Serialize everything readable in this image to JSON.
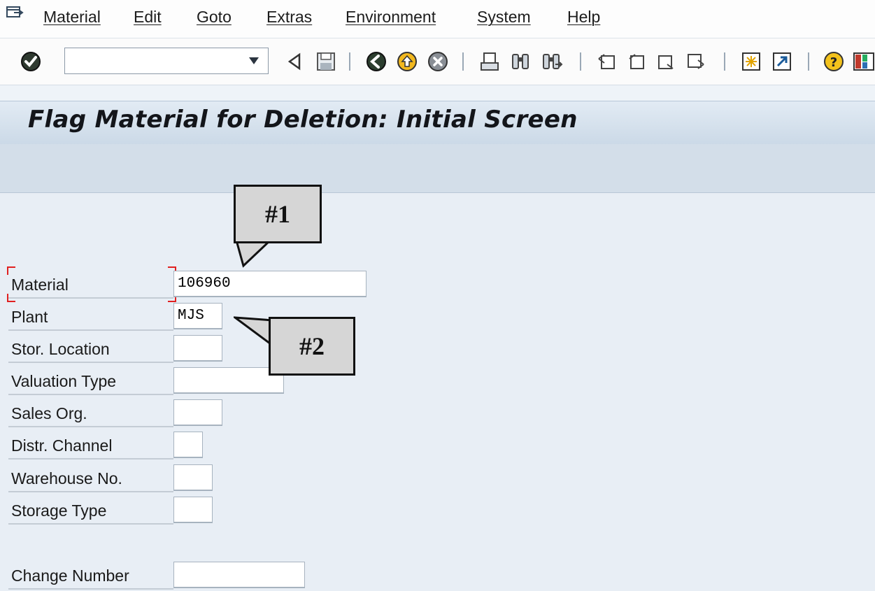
{
  "menu": {
    "items": [
      "Material",
      "Edit",
      "Goto",
      "Extras",
      "Environment",
      "System",
      "Help"
    ]
  },
  "toolbar": {
    "command_field": "",
    "icons": [
      "enter-icon",
      "back-icon",
      "save-icon",
      "green-back-icon",
      "exit-icon",
      "cancel-icon",
      "print-icon",
      "find-icon",
      "find-next-icon",
      "first-page-icon",
      "previous-page-icon",
      "next-page-icon",
      "last-page-icon",
      "create-session-icon",
      "shortcut-icon",
      "help-icon",
      "layout-icon"
    ]
  },
  "screen": {
    "title": "Flag Material for Deletion: Initial Screen"
  },
  "form": {
    "fields": [
      {
        "label": "Material",
        "value": "106960"
      },
      {
        "label": "Plant",
        "value": "MJS"
      },
      {
        "label": "Stor. Location",
        "value": ""
      },
      {
        "label": "Valuation Type",
        "value": ""
      },
      {
        "label": "Sales Org.",
        "value": ""
      },
      {
        "label": "Distr. Channel",
        "value": ""
      },
      {
        "label": "Warehouse No.",
        "value": ""
      },
      {
        "label": "Storage Type",
        "value": ""
      },
      {
        "label": "Change Number",
        "value": ""
      }
    ]
  },
  "callouts": {
    "one": "#1",
    "two": "#2"
  },
  "colors": {
    "background": "#e8eef5",
    "title_bar": "#cbd9e7",
    "required_marker": "#e02020",
    "callout_fill": "#d6d6d6"
  }
}
